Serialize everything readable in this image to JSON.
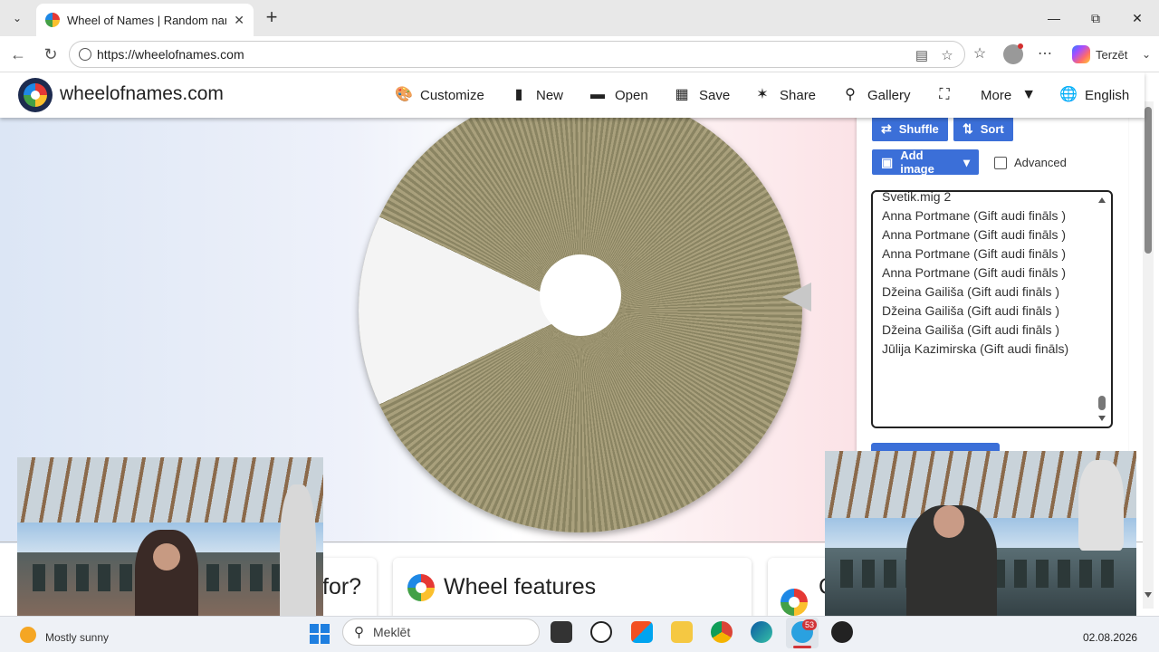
{
  "browser": {
    "tab_title": "Wheel of Names | Random name pi",
    "tab_close": "✕",
    "new_tab": "+",
    "url": "https://wheelofnames.com",
    "copilot_label": "Terzēt",
    "icons": [
      "tab-list-icon",
      "back-icon",
      "refresh-icon",
      "site-info-icon",
      "reader-icon",
      "favorite-star-icon",
      "favorites-icon",
      "profile-icon",
      "more-icon",
      "copilot-icon",
      "minimize-icon",
      "restore-icon",
      "close-icon"
    ]
  },
  "site": {
    "name": "wheelofnames.com",
    "menu": [
      {
        "label": "Customize",
        "icon": "palette-icon"
      },
      {
        "label": "New",
        "icon": "file-icon"
      },
      {
        "label": "Open",
        "icon": "folder-icon"
      },
      {
        "label": "Save",
        "icon": "save-icon"
      },
      {
        "label": "Share",
        "icon": "share-icon"
      },
      {
        "label": "Gallery",
        "icon": "search-icon"
      },
      {
        "label": "",
        "icon": "fullscreen-icon"
      },
      {
        "label": "More",
        "icon": "caret-down-icon"
      },
      {
        "label": "English",
        "icon": "globe-icon"
      }
    ]
  },
  "panel": {
    "shuffle_label": "Shuffle",
    "sort_label": "Sort",
    "add_image_label": "Add image",
    "advanced_label": "Advanced",
    "advanced_checked": false,
    "entries": [
      "Svetik.mig 2",
      "Anna Portmane (Gift audi fināls )",
      "Anna Portmane (Gift audi fināls )",
      "Anna Portmane (Gift audi fināls )",
      "Anna Portmane (Gift audi fināls )",
      "Džeina Gailiša (Gift audi fināls )",
      "Džeina Gailiša (Gift audi fināls )",
      "Džeina Gailiša (Gift audi fināls )",
      "Jūlija Kazimirska (Gift audi fināls)"
    ]
  },
  "cards": [
    {
      "title": "for?"
    },
    {
      "title": "Wheel features"
    },
    {
      "title": "C"
    }
  ],
  "colors": {
    "accent": "#3b6fd8",
    "wheel_olive": "#8a8462",
    "header_bg": "#ffffff"
  },
  "taskbar": {
    "weather": "Mostly sunny",
    "search_placeholder": "Meklēt",
    "telegram_badge": "53",
    "date": "02.08.2026"
  }
}
